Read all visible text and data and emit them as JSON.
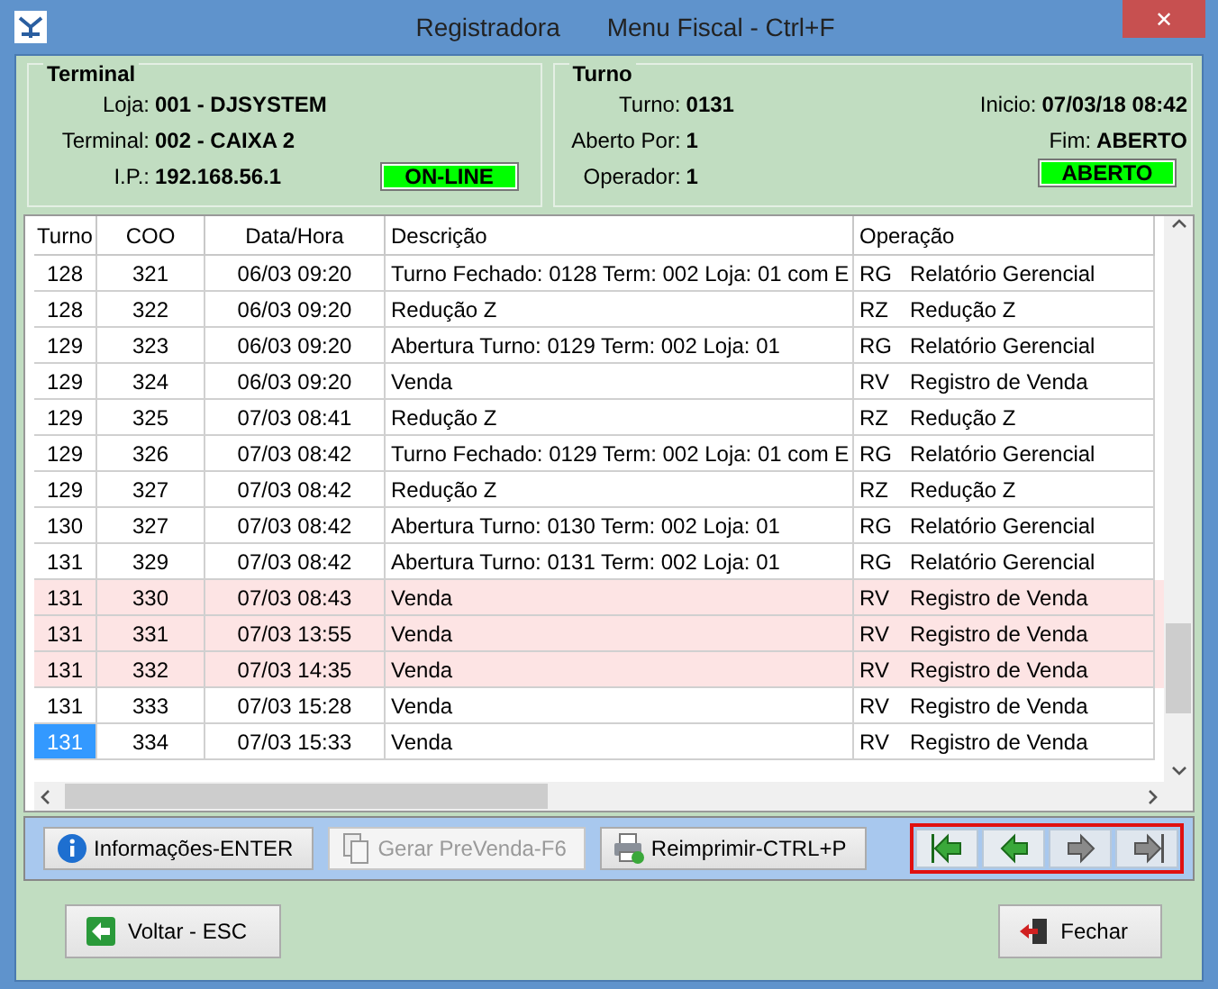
{
  "window": {
    "title": "Registradora",
    "subtitle": "Menu Fiscal - Ctrl+F",
    "close": "✕"
  },
  "terminal": {
    "heading": "Terminal",
    "fields": [
      {
        "label": "Loja:",
        "value": "001 - DJSYSTEM"
      },
      {
        "label": "Terminal:",
        "value": "002 - CAIXA 2"
      },
      {
        "label": "I.P.:",
        "value": "192.168.56.1"
      }
    ],
    "status": "ON-LINE"
  },
  "turno": {
    "heading": "Turno",
    "left": [
      {
        "label": "Turno:",
        "value": "0131"
      },
      {
        "label": "Aberto Por:",
        "value": "1"
      },
      {
        "label": "Operador:",
        "value": "1"
      }
    ],
    "right": [
      {
        "label": "Inicio:",
        "value": "07/03/18 08:42"
      },
      {
        "label": "Fim:",
        "value": "ABERTO"
      }
    ],
    "status": "ABERTO"
  },
  "table": {
    "columns": [
      "Turno",
      "COO",
      "Data/Hora",
      "Descrição",
      "Operação"
    ],
    "rows": [
      {
        "turno": "128",
        "coo": "321",
        "data": "06/03 09:20",
        "descricao": "Turno Fechado: 0128 Term: 002 Loja: 01 com E",
        "code": "RG",
        "operacao": "Relatório Gerencial",
        "highlighted": false,
        "selected": false
      },
      {
        "turno": "128",
        "coo": "322",
        "data": "06/03 09:20",
        "descricao": "Redução Z",
        "code": "RZ",
        "operacao": "Redução Z",
        "highlighted": false,
        "selected": false
      },
      {
        "turno": "129",
        "coo": "323",
        "data": "06/03 09:20",
        "descricao": "Abertura Turno: 0129 Term: 002 Loja: 01",
        "code": "RG",
        "operacao": "Relatório Gerencial",
        "highlighted": false,
        "selected": false
      },
      {
        "turno": "129",
        "coo": "324",
        "data": "06/03 09:20",
        "descricao": "Venda",
        "code": "RV",
        "operacao": "Registro de Venda",
        "highlighted": false,
        "selected": false
      },
      {
        "turno": "129",
        "coo": "325",
        "data": "07/03 08:41",
        "descricao": "Redução Z",
        "code": "RZ",
        "operacao": "Redução Z",
        "highlighted": false,
        "selected": false
      },
      {
        "turno": "129",
        "coo": "326",
        "data": "07/03 08:42",
        "descricao": "Turno Fechado: 0129 Term: 002 Loja: 01 com E",
        "code": "RG",
        "operacao": "Relatório Gerencial",
        "highlighted": false,
        "selected": false
      },
      {
        "turno": "129",
        "coo": "327",
        "data": "07/03 08:42",
        "descricao": "Redução Z",
        "code": "RZ",
        "operacao": "Redução Z",
        "highlighted": false,
        "selected": false
      },
      {
        "turno": "130",
        "coo": "327",
        "data": "07/03 08:42",
        "descricao": "Abertura Turno: 0130 Term: 002 Loja: 01",
        "code": "RG",
        "operacao": "Relatório Gerencial",
        "highlighted": false,
        "selected": false
      },
      {
        "turno": "131",
        "coo": "329",
        "data": "07/03 08:42",
        "descricao": "Abertura Turno: 0131 Term: 002 Loja: 01",
        "code": "RG",
        "operacao": "Relatório Gerencial",
        "highlighted": false,
        "selected": false
      },
      {
        "turno": "131",
        "coo": "330",
        "data": "07/03 08:43",
        "descricao": "Venda",
        "code": "RV",
        "operacao": "Registro de Venda",
        "highlighted": true,
        "selected": false
      },
      {
        "turno": "131",
        "coo": "331",
        "data": "07/03 13:55",
        "descricao": "Venda",
        "code": "RV",
        "operacao": "Registro de Venda",
        "highlighted": true,
        "selected": false
      },
      {
        "turno": "131",
        "coo": "332",
        "data": "07/03 14:35",
        "descricao": "Venda",
        "code": "RV",
        "operacao": "Registro de Venda",
        "highlighted": true,
        "selected": false
      },
      {
        "turno": "131",
        "coo": "333",
        "data": "07/03 15:28",
        "descricao": "Venda",
        "code": "RV",
        "operacao": "Registro de Venda",
        "highlighted": false,
        "selected": false
      },
      {
        "turno": "131",
        "coo": "334",
        "data": "07/03 15:33",
        "descricao": "Venda",
        "code": "RV",
        "operacao": "Registro de Venda",
        "highlighted": false,
        "selected": true
      }
    ]
  },
  "toolbar": [
    {
      "kind": "info",
      "label": "Informações-ENTER",
      "disabled": false
    },
    {
      "kind": "document",
      "label": "Gerar PreVenda-F6",
      "disabled": true
    },
    {
      "kind": "printer",
      "label": "Reimprimir-CTRL+P",
      "disabled": false
    }
  ],
  "navigation": [
    {
      "kind": "first",
      "disabled": false
    },
    {
      "kind": "previous",
      "disabled": false
    },
    {
      "kind": "next",
      "disabled": true
    },
    {
      "kind": "last",
      "disabled": true
    }
  ],
  "footer": {
    "back": "Voltar - ESC",
    "close": "Fechar"
  }
}
